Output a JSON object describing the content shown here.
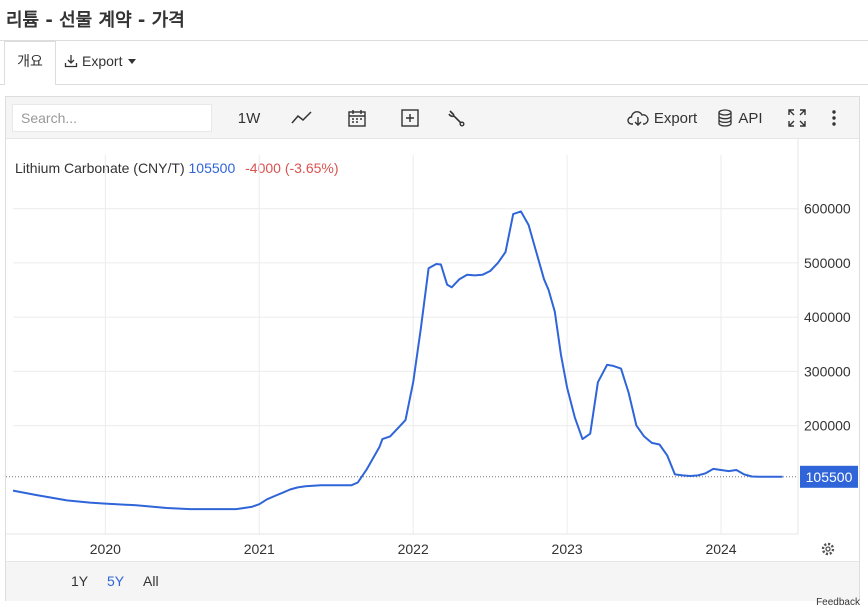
{
  "page": {
    "title": "리튬 - 선물 계약 - 가격"
  },
  "tabs": {
    "overview": "개요",
    "export": "Export"
  },
  "toolbar": {
    "search_placeholder": "Search...",
    "interval": "1W",
    "export": "Export",
    "api": "API"
  },
  "legend": {
    "name": "Lithium Carbonate (CNY/T)",
    "price": "105500",
    "change": "-4000 (-3.65%)"
  },
  "ranges": [
    "1Y",
    "5Y",
    "All"
  ],
  "active_range": "5Y",
  "feedback": "Feedback",
  "colors": {
    "line": "#2f65d8",
    "negative": "#d9534f",
    "last_badge": "#2f65d8"
  },
  "chart_data": {
    "type": "line",
    "series": [
      {
        "name": "Lithium Carbonate (CNY/T)",
        "x": [
          2019.4,
          2019.55,
          2019.75,
          2019.9,
          2020.0,
          2020.2,
          2020.4,
          2020.55,
          2020.85,
          2020.95,
          2021.0,
          2021.05,
          2021.1,
          2021.15,
          2021.2,
          2021.25,
          2021.3,
          2021.4,
          2021.5,
          2021.6,
          2021.64,
          2021.7,
          2021.78,
          2021.8,
          2021.85,
          2021.9,
          2021.95,
          2022.0,
          2022.05,
          2022.1,
          2022.15,
          2022.18,
          2022.22,
          2022.25,
          2022.3,
          2022.35,
          2022.4,
          2022.45,
          2022.5,
          2022.55,
          2022.6,
          2022.65,
          2022.7,
          2022.75,
          2022.8,
          2022.85,
          2022.88,
          2022.92,
          2022.96,
          2023.0,
          2023.05,
          2023.1,
          2023.15,
          2023.2,
          2023.26,
          2023.3,
          2023.35,
          2023.4,
          2023.45,
          2023.5,
          2023.55,
          2023.6,
          2023.65,
          2023.7,
          2023.75,
          2023.8,
          2023.85,
          2023.9,
          2023.95,
          2024.0,
          2024.05,
          2024.1,
          2024.15,
          2024.2,
          2024.25,
          2024.3,
          2024.35,
          2024.4
        ],
        "values": [
          80000,
          72000,
          62000,
          58000,
          56000,
          53000,
          48000,
          46000,
          46000,
          50000,
          55000,
          64000,
          70000,
          76000,
          82000,
          86000,
          88000,
          90000,
          90000,
          90000,
          95000,
          120000,
          160000,
          175000,
          180000,
          195000,
          210000,
          280000,
          380000,
          490000,
          498000,
          497000,
          460000,
          455000,
          470000,
          478000,
          477000,
          478000,
          485000,
          500000,
          520000,
          590000,
          595000,
          570000,
          520000,
          470000,
          450000,
          410000,
          330000,
          270000,
          215000,
          175000,
          185000,
          280000,
          312000,
          310000,
          305000,
          260000,
          200000,
          180000,
          168000,
          165000,
          145000,
          110000,
          108000,
          107000,
          108000,
          112000,
          120000,
          118000,
          116000,
          118000,
          110000,
          106000,
          105500,
          105500,
          105500,
          105500
        ]
      }
    ],
    "x_ticks": [
      "2020",
      "2021",
      "2022",
      "2023",
      "2024"
    ],
    "x_tick_values": [
      2020,
      2021,
      2022,
      2023,
      2024
    ],
    "y_ticks": [
      200000,
      300000,
      400000,
      500000,
      600000
    ],
    "y_tick_labels": [
      "200000",
      "300000",
      "400000",
      "500000",
      "600000"
    ],
    "xlim": [
      2019.4,
      2024.5
    ],
    "ylim": [
      0,
      640000
    ],
    "last_value": 105500,
    "last_value_label": "105500",
    "grid": true,
    "legend": "top-left"
  }
}
